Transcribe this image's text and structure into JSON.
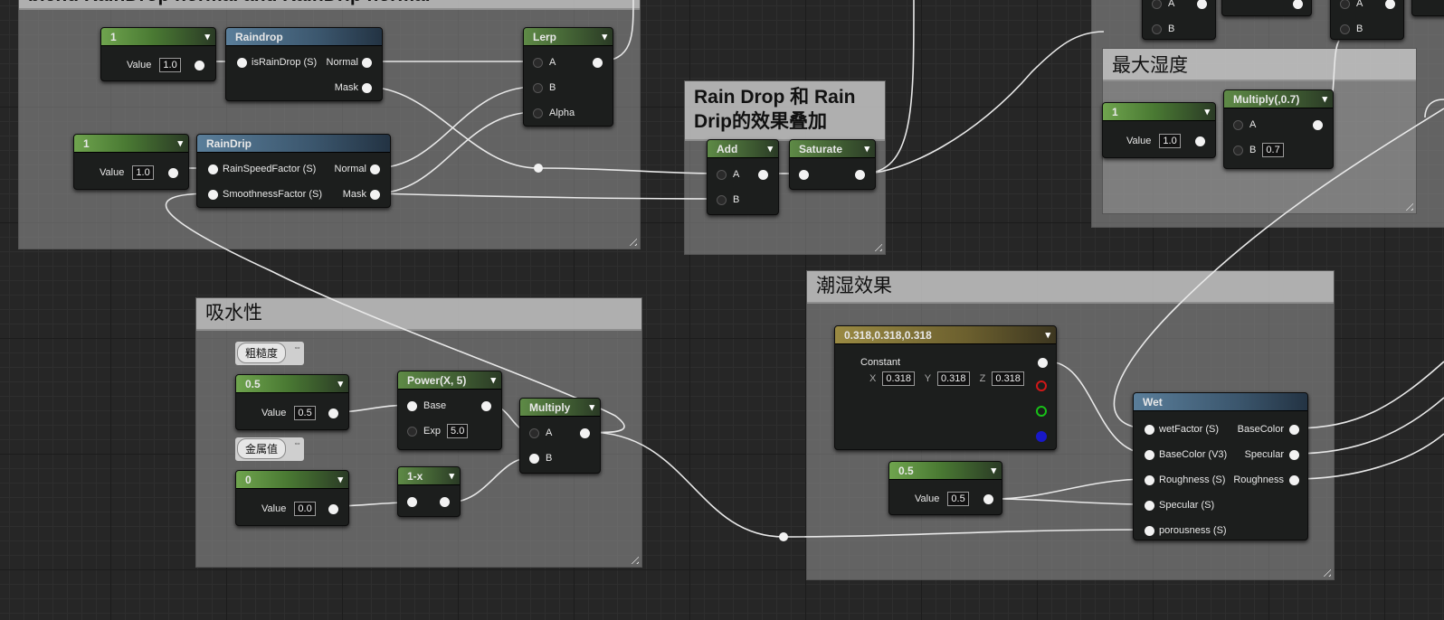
{
  "comments": {
    "blend": "blend RainDrop normal and RainDrip normal",
    "overlay": "Rain Drop 和 Rain Drip的效果叠加",
    "max_humidity": "最大湿度",
    "absorb": "吸水性",
    "wet_effect": "潮湿效果"
  },
  "nodes": {
    "const1_a": {
      "title": "1",
      "value_label": "Value",
      "value": "1.0"
    },
    "raindrop": {
      "title": "Raindrop",
      "in1": "isRainDrop (S)",
      "out1": "Normal",
      "out2": "Mask"
    },
    "lerp": {
      "title": "Lerp",
      "in_a": "A",
      "in_b": "B",
      "in_alpha": "Alpha"
    },
    "const1_b": {
      "title": "1",
      "value_label": "Value",
      "value": "1.0"
    },
    "raindrip": {
      "title": "RainDrip",
      "in1": "RainSpeedFactor (S)",
      "in2": "SmoothnessFactor (S)",
      "out1": "Normal",
      "out2": "Mask"
    },
    "add": {
      "title": "Add",
      "in_a": "A",
      "in_b": "B"
    },
    "saturate": {
      "title": "Saturate"
    },
    "topright_a": {
      "in_a": "A",
      "in_b": "B"
    },
    "topright_b": {
      "in_a": "A",
      "in_b": "B"
    },
    "const1_c": {
      "title": "1",
      "value_label": "Value",
      "value": "1.0"
    },
    "multiply07": {
      "title": "Multiply(,0.7)",
      "in_a": "A",
      "in_b": "B",
      "b_value": "0.7"
    },
    "roughness_tag": "粗糙度",
    "metal_tag": "金属值",
    "const05_a": {
      "title": "0.5",
      "value_label": "Value",
      "value": "0.5"
    },
    "power": {
      "title": "Power(X, 5)",
      "in_base": "Base",
      "in_exp": "Exp",
      "exp_value": "5.0"
    },
    "multiply": {
      "title": "Multiply",
      "in_a": "A",
      "in_b": "B"
    },
    "const0": {
      "title": "0",
      "value_label": "Value",
      "value": "0.0"
    },
    "oneminus": {
      "title": "1-x"
    },
    "vec3": {
      "title": "0.318,0.318,0.318",
      "constant_label": "Constant",
      "x_label": "X",
      "x": "0.318",
      "y_label": "Y",
      "y": "0.318",
      "z_label": "Z",
      "z": "0.318"
    },
    "const05_b": {
      "title": "0.5",
      "value_label": "Value",
      "value": "0.5"
    },
    "wet": {
      "title": "Wet",
      "in1": "wetFactor (S)",
      "in2": "BaseColor (V3)",
      "in3": "Roughness (S)",
      "in4": "Specular (S)",
      "in5": "porousness (S)",
      "out1": "BaseColor",
      "out2": "Specular",
      "out3": "Roughness"
    }
  },
  "colors": {
    "pin_red": "#d01818",
    "pin_green": "#18c018",
    "pin_blue": "#1818c8"
  }
}
